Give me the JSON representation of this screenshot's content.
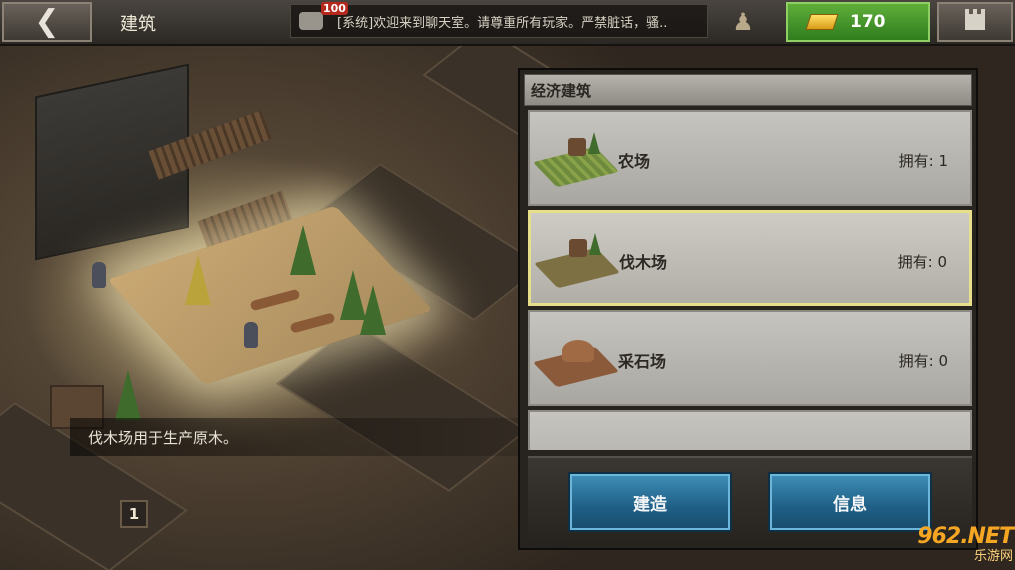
{
  "header": {
    "title": "建筑",
    "chat_badge": "100",
    "chat_message": "[系统]欢迎来到聊天室。请尊重所有玩家。严禁脏话，骚..",
    "gold": "170"
  },
  "world": {
    "description": "伐木场用于生产原木。",
    "level_marker": "1"
  },
  "panel": {
    "header": "经济建筑",
    "buildings": [
      {
        "name": "农场",
        "owned": "拥有: 1",
        "thumbnail_icon": "farm-icon"
      },
      {
        "name": "伐木场",
        "owned": "拥有: 0",
        "thumbnail_icon": "lumber-mill-icon",
        "selected": true
      },
      {
        "name": "采石场",
        "owned": "拥有: 0",
        "thumbnail_icon": "quarry-icon"
      }
    ],
    "build_button": "建造",
    "info_button": "信息"
  },
  "watermark": {
    "top": "962.NET",
    "bottom": "乐游网"
  },
  "colors": {
    "gold_button": "#3f8f28",
    "action_button": "#1f5f86",
    "selected_border": "#e8df8a"
  }
}
